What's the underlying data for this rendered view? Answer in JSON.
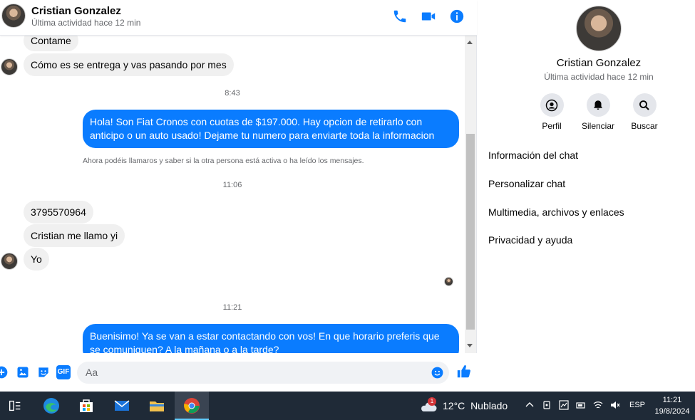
{
  "header": {
    "contact_name": "Cristian Gonzalez",
    "status": "Última actividad hace 12 min"
  },
  "messages": {
    "m1": "Contame",
    "m2": "Cómo es se entrega y vas pasando por mes",
    "t1": "8:43",
    "m3": "Hola! Son Fiat Cronos con cuotas de $197.000. Hay opcion de retirarlo con anticipo o un auto usado! Dejame tu numero para enviarte toda la informacion",
    "note": "Ahora podéis llamaros y saber si la otra persona está activa o ha leído los mensajes.",
    "t2": "11:06",
    "m4": "3795570964",
    "m5": "Cristian me llamo yi",
    "m6": "Yo",
    "t3": "11:21",
    "m7": "Buenisimo! Ya se van a estar contactando con vos! En que horario preferis que se comuniquen? A la mañana o a la tarde?"
  },
  "composer": {
    "placeholder": "Aa",
    "gif_label": "GIF"
  },
  "info_panel": {
    "name": "Cristian Gonzalez",
    "status": "Última actividad hace 12 min",
    "actions": [
      {
        "label": "Perfil",
        "icon": "profile-icon"
      },
      {
        "label": "Silenciar",
        "icon": "bell-icon"
      },
      {
        "label": "Buscar",
        "icon": "search-icon"
      }
    ],
    "menu": [
      "Información del chat",
      "Personalizar chat",
      "Multimedia, archivos y enlaces",
      "Privacidad y ayuda"
    ]
  },
  "taskbar": {
    "weather_temp": "12°C",
    "weather_text": "Nublado",
    "weather_badge": "1",
    "language": "ESP",
    "time": "11:21",
    "date": "19/8/2024"
  },
  "colors": {
    "accent": "#0a7cff",
    "bubble_in": "#f0f0f0",
    "taskbar": "#1f2a37"
  }
}
